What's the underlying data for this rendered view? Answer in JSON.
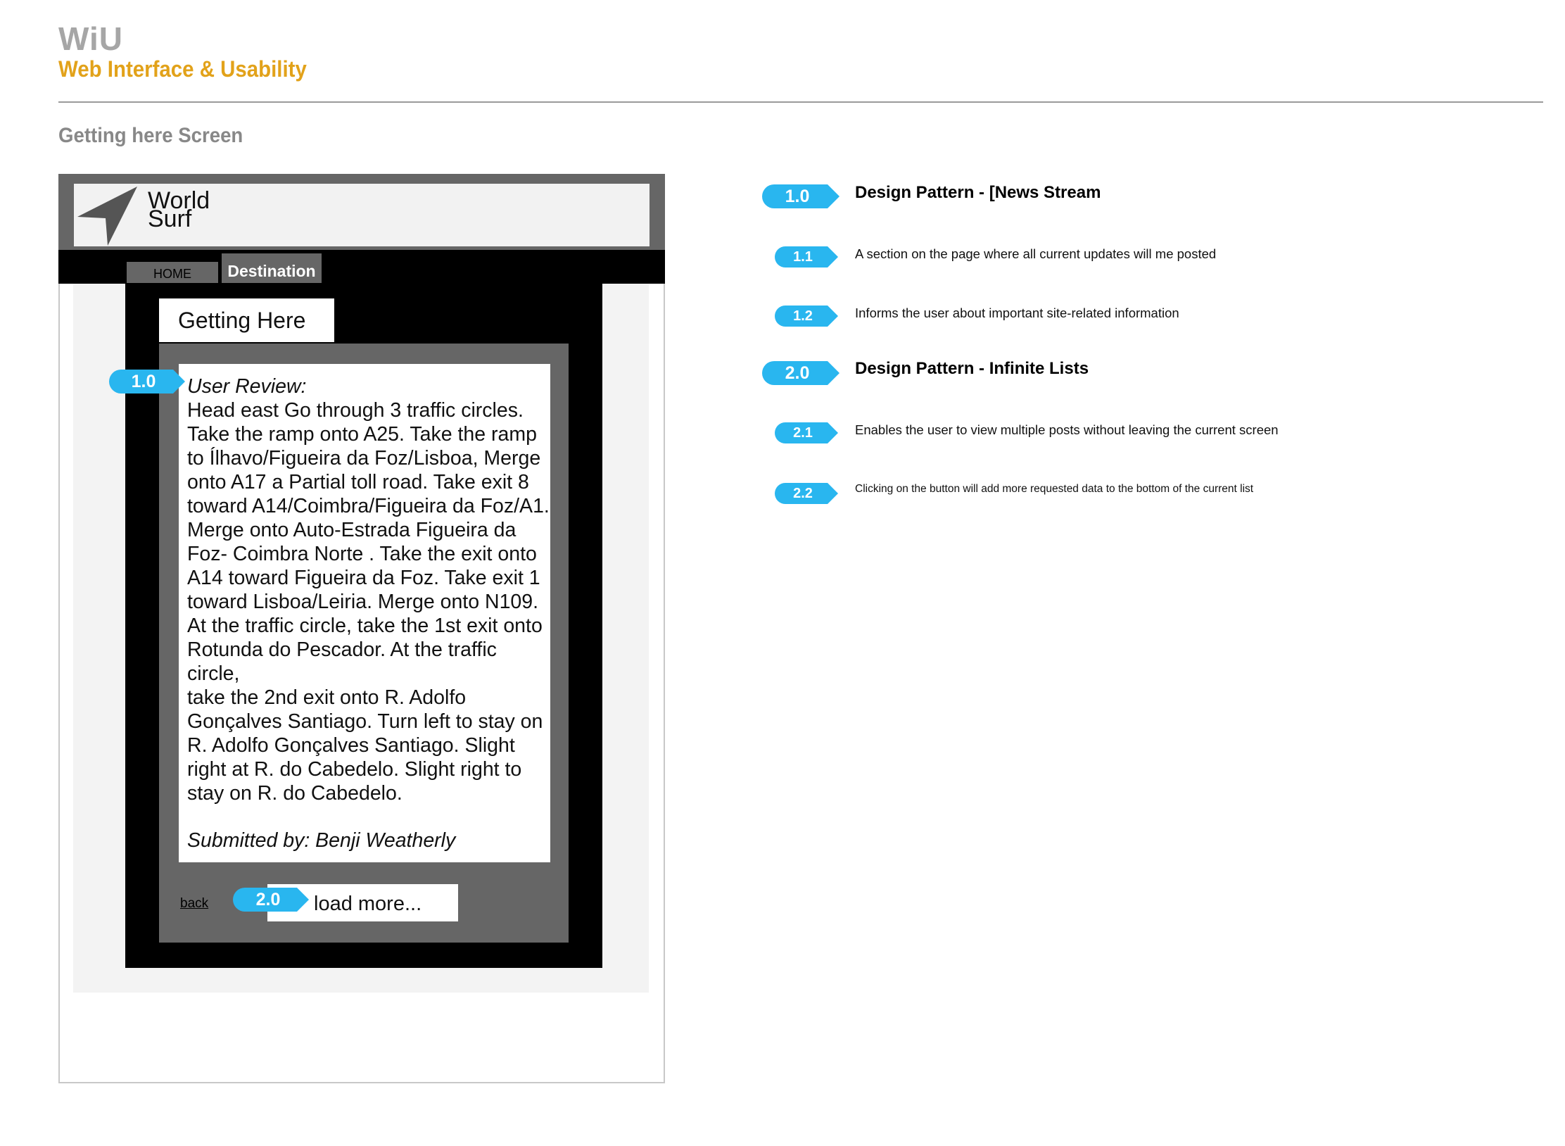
{
  "header": {
    "brand": "WiU",
    "subtitle": "Web Interface & Usability",
    "screen_title": "Getting here Screen"
  },
  "colors": {
    "accent_orange": "#e2a21a",
    "badge_blue": "#29b6ef",
    "grey": "#666666"
  },
  "mockup": {
    "logo": {
      "line1": "World",
      "line2": "Surf",
      "icon": "navigation-arrow-icon"
    },
    "nav": {
      "home": "HOME",
      "destination": "Destination"
    },
    "tab": "Getting Here",
    "review": {
      "heading": "User Review:",
      "body": "Head east Go through 3 traffic circles.\nTake the ramp onto A25. Take the ramp\nto Ílhavo/Figueira da Foz/Lisboa, Merge\nonto A17 a Partial toll road. Take exit 8\ntoward A14/Coimbra/Figueira da Foz/A1.\nMerge onto Auto-Estrada Figueira da\nFoz- Coimbra Norte . Take the exit onto\nA14 toward Figueira da Foz. Take exit 1\ntoward Lisboa/Leiria. Merge onto N109.\nAt the traffic circle, take the 1st exit onto\nRotunda do Pescador. At the traffic circle,\ntake the 2nd exit onto R. Adolfo\nGonçalves Santiago. Turn left to stay on\nR. Adolfo Gonçalves Santiago. Slight\nright at R. do Cabedelo. Slight right to\nstay on R. do Cabedelo.",
      "submitted": "Submitted by: Benji Weatherly"
    },
    "back": "back",
    "load_more": "load more...",
    "badges": {
      "review": "1.0",
      "load_more": "2.0"
    }
  },
  "annotations": [
    {
      "num": "1.0",
      "text": "Design Pattern - [News Stream"
    },
    {
      "num": "1.1",
      "text": "A section on the page where all current updates will me posted"
    },
    {
      "num": "1.2",
      "text": "Informs the user about important site-related information"
    },
    {
      "num": "2.0",
      "text": "Design Pattern - Infinite Lists"
    },
    {
      "num": "2.1",
      "text": "Enables the user to view multiple posts without leaving the current screen"
    },
    {
      "num": "2.2",
      "text": "Clicking on the button will add more requested data to the bottom of the current list"
    }
  ]
}
